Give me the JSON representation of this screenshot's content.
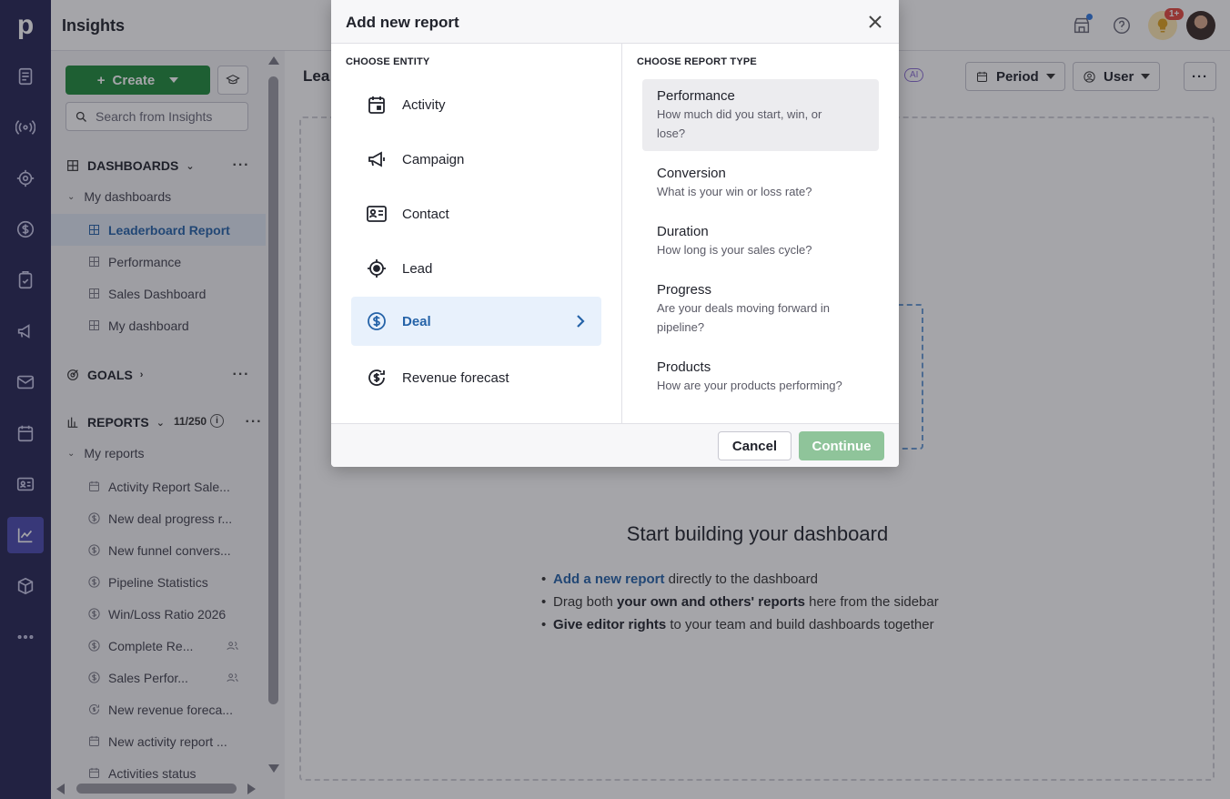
{
  "app": {
    "logo": "p",
    "title": "Insights",
    "tip_count": "1+"
  },
  "nav": {
    "icons": [
      "deals-icon",
      "leads-inbox-icon",
      "target-icon",
      "dollar-icon",
      "tasks-icon",
      "campaign-icon",
      "mail-icon",
      "calendar-icon",
      "contacts-icon",
      "insights-icon",
      "products-icon",
      "more-icon"
    ],
    "active": "insights-icon"
  },
  "sidebar": {
    "create_label": "Create",
    "search_placeholder": "Search from Insights",
    "dashboards_header": "DASHBOARDS",
    "my_dashboards": "My dashboards",
    "dashboards": [
      {
        "label": "Leaderboard Report",
        "selected": true
      },
      {
        "label": "Performance"
      },
      {
        "label": "Sales Dashboard"
      },
      {
        "label": "My dashboard"
      }
    ],
    "goals_header": "GOALS",
    "reports_header": "REPORTS",
    "reports_count": "11/250",
    "my_reports": "My reports",
    "reports": [
      {
        "label": "Activity Report Sale...",
        "icon": "calendar-icon"
      },
      {
        "label": "New deal progress r...",
        "icon": "dollar-icon"
      },
      {
        "label": "New funnel convers...",
        "icon": "dollar-icon"
      },
      {
        "label": "Pipeline Statistics",
        "icon": "dollar-icon"
      },
      {
        "label": "Win/Loss Ratio 2026",
        "icon": "dollar-icon"
      },
      {
        "label": "Complete Re...",
        "icon": "dollar-icon",
        "shared": true
      },
      {
        "label": "Sales Perfor...",
        "icon": "dollar-icon",
        "shared": true
      },
      {
        "label": "New revenue foreca...",
        "icon": "revenue-forecast-icon"
      },
      {
        "label": "New activity report ...",
        "icon": "calendar-icon"
      },
      {
        "label": "Activities status",
        "icon": "calendar-icon"
      }
    ]
  },
  "main": {
    "title": "Lea",
    "period_label": "Period",
    "user_label": "User",
    "ai_label": "AI",
    "empty_title": "Start building your dashboard",
    "bullet1_link": "Add a new report",
    "bullet1_rest": " directly to the dashboard",
    "bullet2_pre": "Drag both ",
    "bullet2_bold": "your own and others' reports",
    "bullet2_post": " here from the sidebar",
    "bullet3_bold": "Give editor rights",
    "bullet3_post": " to your team and build dashboards together"
  },
  "modal": {
    "title": "Add new report",
    "entity_header": "CHOOSE ENTITY",
    "type_header": "CHOOSE REPORT TYPE",
    "entities": [
      {
        "label": "Activity",
        "icon": "calendar-icon"
      },
      {
        "label": "Campaign",
        "icon": "megaphone-icon"
      },
      {
        "label": "Contact",
        "icon": "contact-card-icon"
      },
      {
        "label": "Lead",
        "icon": "lead-target-icon"
      },
      {
        "label": "Deal",
        "icon": "dollar-icon",
        "selected": true
      },
      {
        "label": "Revenue forecast",
        "icon": "revenue-forecast-icon"
      }
    ],
    "report_types": [
      {
        "name": "Performance",
        "desc": "How much did you start, win, or lose?",
        "selected": true
      },
      {
        "name": "Conversion",
        "desc": "What is your win or loss rate?"
      },
      {
        "name": "Duration",
        "desc": "How long is your sales cycle?"
      },
      {
        "name": "Progress",
        "desc": "Are your deals moving forward in pipeline?"
      },
      {
        "name": "Products",
        "desc": "How are your products performing?"
      }
    ],
    "cancel_label": "Cancel",
    "continue_label": "Continue"
  }
}
